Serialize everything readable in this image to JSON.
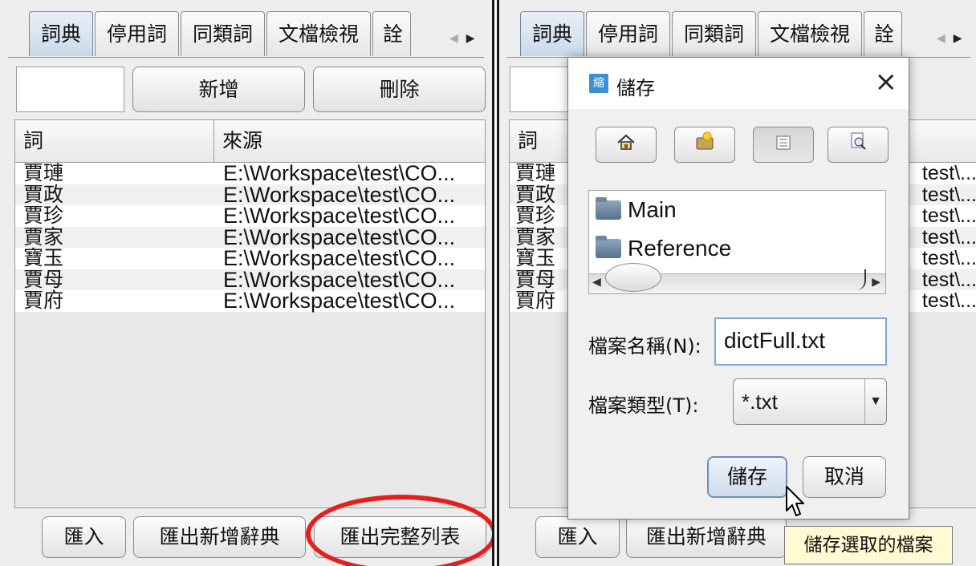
{
  "tabs": [
    "詞典",
    "停用詞",
    "同類詞",
    "文檔檢視",
    "詮"
  ],
  "top_buttons": {
    "add": "新增",
    "delete": "刪除"
  },
  "table": {
    "headers": [
      "詞",
      "來源"
    ],
    "rows": [
      [
        "賈璉",
        "E:\\Workspace\\test\\CO..."
      ],
      [
        "賈政",
        "E:\\Workspace\\test\\CO..."
      ],
      [
        "賈珍",
        "E:\\Workspace\\test\\CO..."
      ],
      [
        "賈家",
        "E:\\Workspace\\test\\CO..."
      ],
      [
        "寶玉",
        "E:\\Workspace\\test\\CO..."
      ],
      [
        "賈母",
        "E:\\Workspace\\test\\CO..."
      ],
      [
        "賈府",
        "E:\\Workspace\\test\\CO..."
      ]
    ],
    "right_suffix": "test\\..."
  },
  "bottom_buttons": {
    "import": "匯入",
    "export_new": "匯出新增辭典",
    "export_full": "匯出完整列表"
  },
  "dialog": {
    "title": "儲存",
    "close": "×",
    "logo": "縮",
    "folders": [
      "Main",
      "Reference"
    ],
    "filename_label": "檔案名稱(N):",
    "filename_value": "dictFull.txt",
    "filetype_label": "檔案類型(T):",
    "filetype_value": "*.txt",
    "save_button": "儲存",
    "cancel_button": "取消"
  },
  "tooltip": "儲存選取的檔案",
  "colors": {
    "highlight_circle": "#e51e1e",
    "tooltip_bg": "#fffad2",
    "active_tab": "#c9d9ea"
  }
}
